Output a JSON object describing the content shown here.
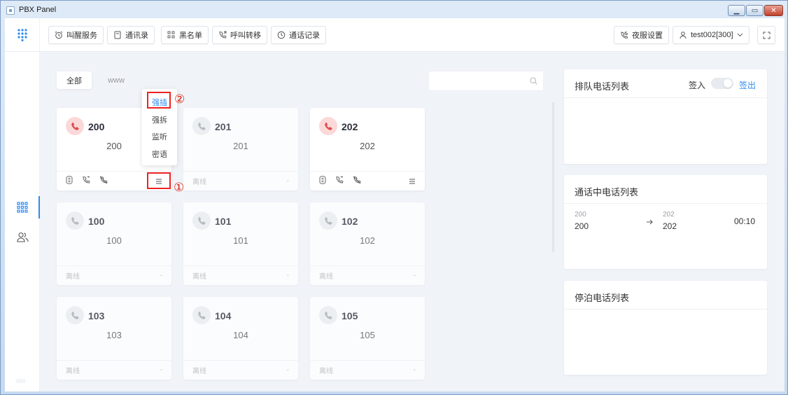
{
  "window": {
    "title": "PBX Panel"
  },
  "toolbar": {
    "buttons": [
      {
        "label": "叫醒服务",
        "icon": "alarm-clock-icon"
      },
      {
        "label": "通讯录",
        "icon": "contact-book-icon"
      },
      {
        "label": "黑名单",
        "icon": "grid-block-icon"
      },
      {
        "label": "呼叫转移",
        "icon": "call-forward-icon"
      },
      {
        "label": "通话记录",
        "icon": "clock-icon"
      }
    ],
    "night_mode": {
      "label": "夜服设置",
      "icon": "moon-phone-icon"
    },
    "user": {
      "label": "test002[300]",
      "icon": "user-icon"
    },
    "fullscreen_icon": "fullscreen-icon"
  },
  "sidebar": {
    "items": [
      {
        "name": "dialpad",
        "icon": "grid-icon",
        "active": true
      },
      {
        "name": "users",
        "icon": "users-icon",
        "active": false
      }
    ]
  },
  "tabs": [
    {
      "label": "全部",
      "active": true
    },
    {
      "label": "www",
      "active": false
    }
  ],
  "search": {
    "placeholder": ""
  },
  "cards": [
    {
      "ext": "200",
      "name": "200",
      "state": "busy",
      "status": "",
      "dash": ""
    },
    {
      "ext": "201",
      "name": "201",
      "state": "offline",
      "status": "离线",
      "dash": "-"
    },
    {
      "ext": "202",
      "name": "202",
      "state": "busy",
      "status": "",
      "dash": ""
    },
    {
      "ext": "100",
      "name": "100",
      "state": "offline",
      "status": "离线",
      "dash": "-"
    },
    {
      "ext": "101",
      "name": "101",
      "state": "offline",
      "status": "离线",
      "dash": "-"
    },
    {
      "ext": "102",
      "name": "102",
      "state": "offline",
      "status": "离线",
      "dash": "-"
    },
    {
      "ext": "103",
      "name": "103",
      "state": "offline",
      "status": "离线",
      "dash": "-"
    },
    {
      "ext": "104",
      "name": "104",
      "state": "offline",
      "status": "离线",
      "dash": "-"
    },
    {
      "ext": "105",
      "name": "105",
      "state": "offline",
      "status": "离线",
      "dash": "-"
    }
  ],
  "popup_menu": {
    "items": [
      "强插",
      "强拆",
      "监听",
      "密语"
    ],
    "highlighted_index": 0
  },
  "annotations": {
    "one": "①",
    "two": "②"
  },
  "queue_panel": {
    "title": "排队电话列表",
    "signin_label": "签入",
    "signout_label": "签出",
    "toggle_on": false
  },
  "active_calls_panel": {
    "title": "通话中电话列表",
    "calls": [
      {
        "from_small": "200",
        "from": "200",
        "to_small": "202",
        "to": "202",
        "duration": "00:10"
      }
    ]
  },
  "parked_panel": {
    "title": "停泊电话列表"
  },
  "colors": {
    "accent": "#2d8cf0",
    "busy_bg": "#fbd9d9",
    "busy_icon": "#e04b4b",
    "offline_bg": "#eceef1",
    "offline_icon": "#a6abb3",
    "annotation_red": "#e22"
  }
}
